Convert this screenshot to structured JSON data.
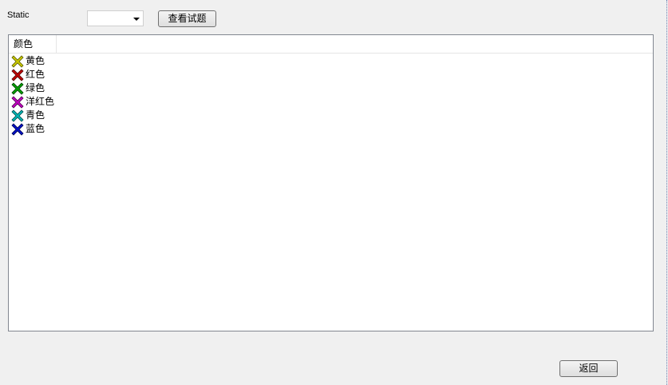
{
  "static_label": "Static",
  "view_button_label": "查看试题",
  "back_button_label": "返回",
  "list": {
    "column_header": "颜色",
    "items": [
      {
        "label": "黄色",
        "color": "#c8c800",
        "icon": "yellow-x-icon"
      },
      {
        "label": "红色",
        "color": "#c00000",
        "icon": "red-x-icon"
      },
      {
        "label": "绿色",
        "color": "#00a000",
        "icon": "green-x-icon"
      },
      {
        "label": "洋红色",
        "color": "#c000c0",
        "icon": "magenta-x-icon"
      },
      {
        "label": "青色",
        "color": "#00b4b4",
        "icon": "cyan-x-icon"
      },
      {
        "label": "蓝色",
        "color": "#0010c8",
        "icon": "blue-x-icon"
      }
    ]
  }
}
